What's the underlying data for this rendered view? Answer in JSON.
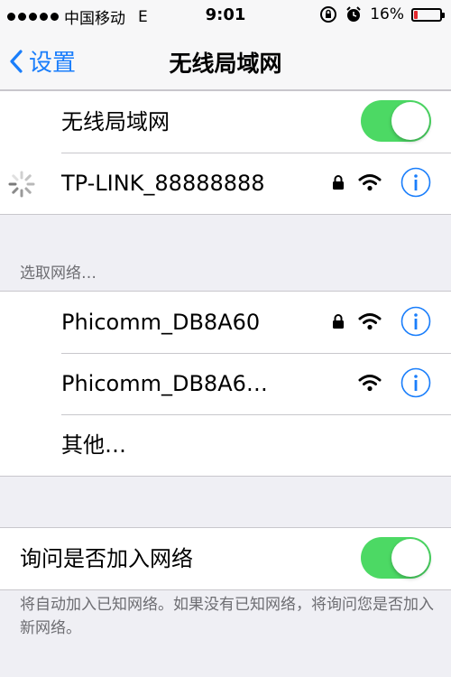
{
  "status_bar": {
    "carrier": "中国移动",
    "network": "E",
    "time": "9:01",
    "battery_percent": "16%",
    "battery_level": 0.16,
    "battery_color": "#e3282d",
    "icons": [
      "signal-dots-icon",
      "rotation-lock-icon",
      "alarm-icon",
      "battery-icon"
    ]
  },
  "nav": {
    "back_label": "设置",
    "title": "无线局域网",
    "accent_color": "#1a7efb"
  },
  "wifi_toggle": {
    "label": "无线局域网",
    "on": true,
    "color": "#4cd964"
  },
  "current_network": {
    "name": "TP-LINK_88888888",
    "locked": true,
    "connecting": true
  },
  "choose_network": {
    "header": "选取网络…",
    "networks": [
      {
        "name": "Phicomm_DB8A60",
        "locked": true
      },
      {
        "name": "Phicomm_DB8A6…",
        "locked": false
      }
    ],
    "other_label": "其他…"
  },
  "ask_to_join": {
    "label": "询问是否加入网络",
    "on": true,
    "footer": "将自动加入已知网络。如果没有已知网络，将询问您是否加入新网络。"
  }
}
